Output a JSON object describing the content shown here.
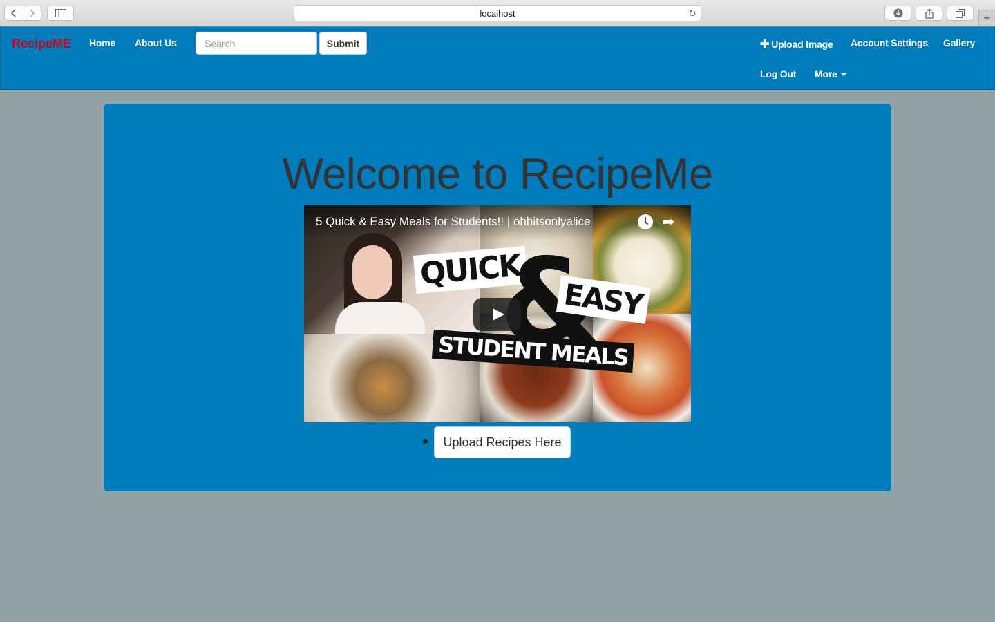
{
  "browser": {
    "url": "localhost"
  },
  "navbar": {
    "brand": "RecipeME",
    "links": {
      "home": "Home",
      "about": "About Us",
      "upload_image": "Upload Image",
      "account_settings": "Account Settings",
      "gallery": "Gallery",
      "log_out": "Log Out",
      "more": "More"
    },
    "search": {
      "placeholder": "Search",
      "submit_label": "Submit"
    }
  },
  "main": {
    "heading": "Welcome to RecipeMe",
    "video": {
      "title": "5 Quick & Easy Meals for Students!! | ohhitsonlyalice",
      "thumbnail_text": {
        "quick": "QUICK",
        "amp": "&",
        "easy": "EASY",
        "student_meals": "STUDENT MEALS"
      }
    },
    "upload_button": "Upload Recipes Here"
  },
  "colors": {
    "page_bg": "#91a2a5",
    "primary": "#007bbb",
    "brand": "#d0021b"
  }
}
